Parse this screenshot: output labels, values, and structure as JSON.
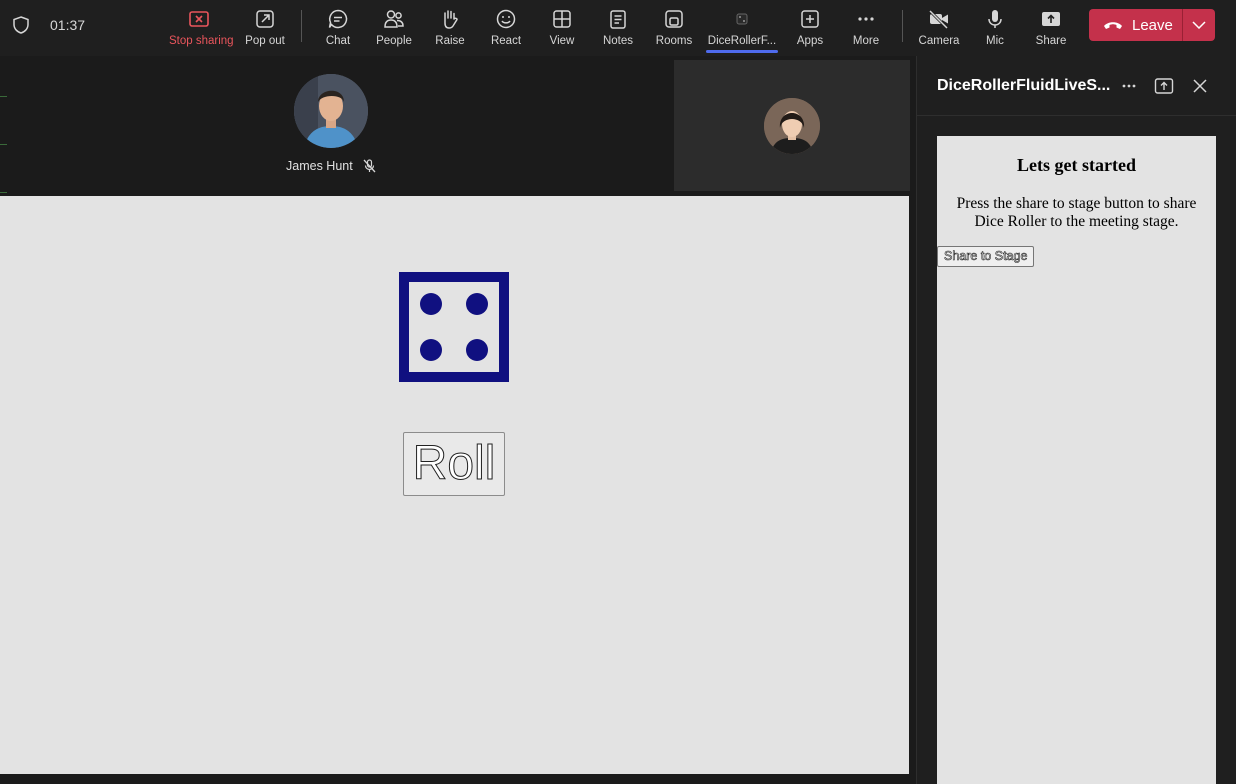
{
  "meeting": {
    "timer": "01:37"
  },
  "toolbar": {
    "stop_sharing": "Stop sharing",
    "pop_out": "Pop out",
    "chat": "Chat",
    "people": "People",
    "raise": "Raise",
    "react": "React",
    "view": "View",
    "notes": "Notes",
    "rooms": "Rooms",
    "app_tab": "DiceRollerF...",
    "apps": "Apps",
    "more": "More",
    "camera": "Camera",
    "mic": "Mic",
    "share": "Share",
    "leave": "Leave"
  },
  "participants": [
    {
      "name": "James Hunt",
      "muted": true
    },
    {
      "name": "",
      "muted": false
    }
  ],
  "stage_app": {
    "die_value": 4,
    "roll_label": "Roll"
  },
  "side_panel": {
    "title": "DiceRollerFluidLiveS...",
    "heading": "Lets get started",
    "body": "Press the share to stage button to share Dice Roller to the meeting stage.",
    "share_button": "Share to Stage"
  },
  "colors": {
    "leave_red": "#c4314b",
    "stop_sharing_red": "#e9555c",
    "die_blue": "#101080",
    "accent": "#4f6bed"
  }
}
